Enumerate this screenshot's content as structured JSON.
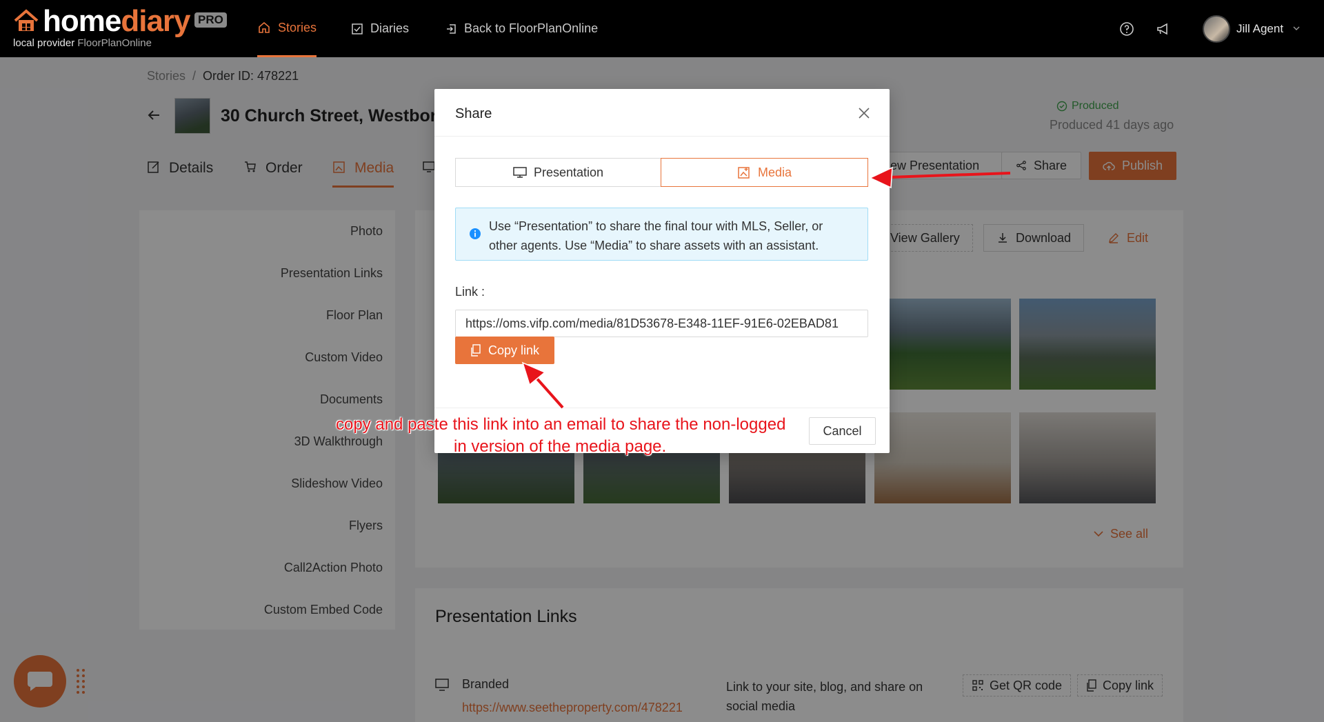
{
  "app": {
    "logo_home": "home",
    "logo_diary": "diary",
    "logo_pro": "PRO",
    "provider_label": "local provider",
    "provider_name": "FloorPlanOnline"
  },
  "nav": {
    "stories": "Stories",
    "diaries": "Diaries",
    "back": "Back to FloorPlanOnline"
  },
  "user": {
    "name": "Jill Agent"
  },
  "breadcrumb": {
    "root": "Stories",
    "sep": "/",
    "current": "Order ID: 478221"
  },
  "property": {
    "title": "30 Church Street, Westbor"
  },
  "status": {
    "label": "Produced",
    "ago": "Produced 41 days ago"
  },
  "tabs": {
    "details": "Details",
    "order": "Order",
    "media": "Media"
  },
  "actions": {
    "view_presentation": "ew Presentation",
    "share": "Share",
    "publish": "Publish"
  },
  "sidenav": {
    "items": [
      "Photo",
      "Presentation Links",
      "Floor Plan",
      "Custom Video",
      "Documents",
      "3D Walkthrough",
      "Slideshow Video",
      "Flyers",
      "Call2Action Photo",
      "Custom Embed Code"
    ]
  },
  "gallery": {
    "view_gallery": "View Gallery",
    "download": "Download",
    "edit": "Edit",
    "see_all": "See all"
  },
  "presentation_links": {
    "title": "Presentation Links",
    "branded_label": "Branded",
    "branded_url": "https://www.seetheproperty.com/478221",
    "branded_desc": "Link to your site, blog, and share on social media",
    "qr_button": "Get QR code",
    "copy_button": "Copy link"
  },
  "modal": {
    "title": "Share",
    "seg_presentation": "Presentation",
    "seg_media": "Media",
    "info": "Use “Presentation” to share the final tour with MLS, Seller, or other agents. Use “Media” to share assets with an assistant.",
    "link_label": "Link :",
    "link_value": "https://oms.vifp.com/media/81D53678-E348-11EF-91E6-02EBAD81",
    "copy_button": "Copy link",
    "cancel_button": "Cancel"
  },
  "annotation": {
    "line1": "copy and paste this link into an email to share the non-logged",
    "line2": "in version of the media page."
  },
  "colors": {
    "accent": "#e8743b",
    "success": "#3ea34b",
    "info_bg": "#e7f6fd",
    "annotation": "#e8141b"
  }
}
